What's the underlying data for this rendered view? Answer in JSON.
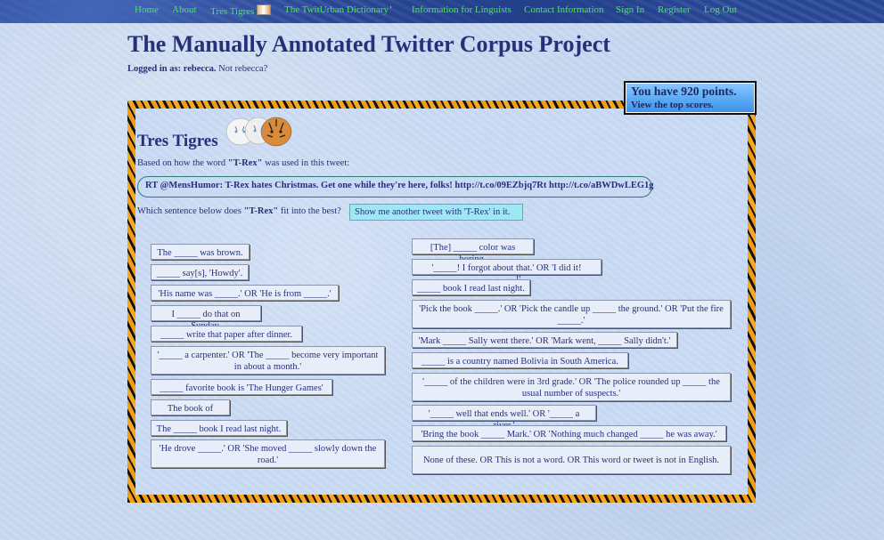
{
  "nav": {
    "home": "Home",
    "about": "About",
    "tres_tigres": "Tres Tigres",
    "dictionary": "The TwitUrban Dictionary",
    "linguists": "Information for Linguists",
    "contact": "Contact Information",
    "sign_in": "Sign In",
    "register": "Register",
    "log_out": "Log Out"
  },
  "header": {
    "title": "The Manually Annotated Twitter Corpus Project",
    "logged_in_prefix": "Logged in as: rebecca.",
    "not_user": "Not rebecca?"
  },
  "points": {
    "line": "You have 920 points.",
    "top_scores_link": "View the top scores."
  },
  "game": {
    "title": "Tres Tigres",
    "based_on_prefix": "Based on how the word ",
    "word": "\"T-Rex\"",
    "based_on_suffix": " was used in this tweet:",
    "tweet": "RT @MensHumor: T-Rex hates Christmas. Get one while they're here, folks! http://t.co/09EZbjq7Rt http://t.co/aBWDwLEG1g",
    "which_prefix": "Which sentence below does ",
    "which_suffix": " fit into the best?",
    "another_button": "Show me another tweet with 'T-Rex' in it."
  },
  "answers_left": [
    "The _____ was brown.",
    "_____ say[s], 'Howdy'.",
    "'His name was _____.' OR 'He is from _____.'",
    "I _____ do that on Sunday.",
    "_____ write that paper after dinner.",
    "'_____ a carpenter.' OR 'The _____ become very important in about a month.'",
    "_____ favorite book is 'The Hunger Games'",
    "The book of _____.",
    "The _____ book I read last night.",
    "'He drove _____.' OR 'She moved _____ slowly down the road.'"
  ],
  "answers_right": [
    "[The] _____ color was boring.",
    "'_____! I forgot about that.' OR 'I did it! _____!'",
    "_____ book I read last night.",
    "'Pick the book _____.' OR 'Pick the candle up _____ the ground.' OR 'Put the fire _____.'",
    "'Mark _____ Sally went there.' OR 'Mark went, _____ Sally didn't.'",
    "_____ is a country named Bolivia in South America.",
    "'_____ of the children were in 3rd grade.' OR 'The police rounded up _____ the usual number of suspects.'",
    "'_____ well that ends well.' OR '_____ a river.'",
    "'Bring the book _____ Mark.' OR 'Nothing much changed _____ he was away.'",
    "None of these. OR This is not a word. OR This word or tweet is not in English."
  ]
}
